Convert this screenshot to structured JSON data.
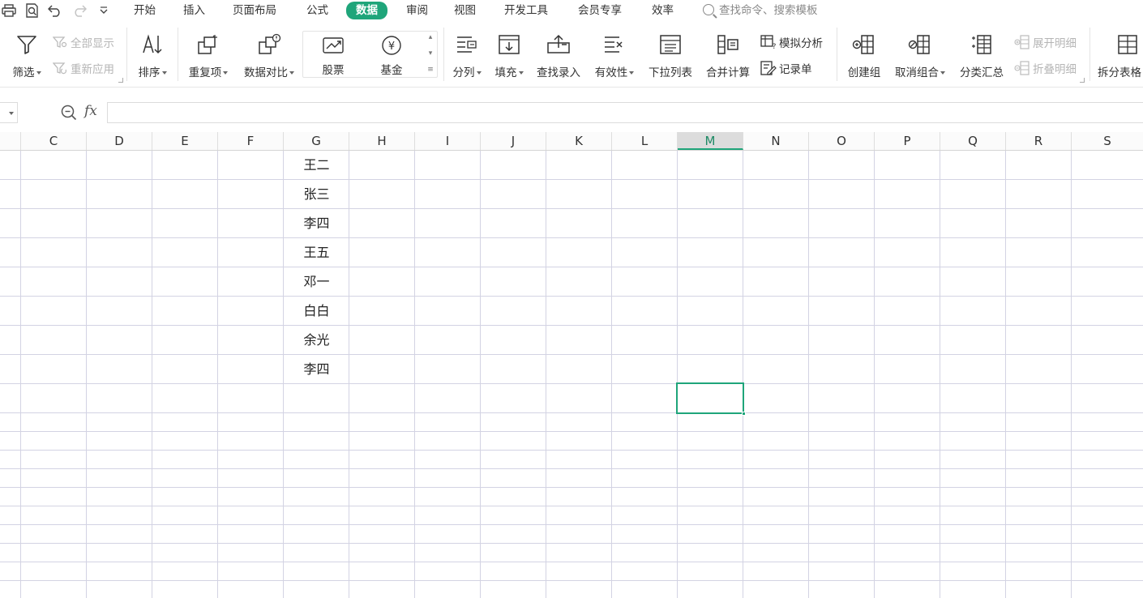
{
  "menu": {
    "tabs": [
      "开始",
      "插入",
      "页面布局",
      "公式",
      "数据",
      "审阅",
      "视图",
      "开发工具",
      "会员专享",
      "效率"
    ],
    "active_tab": "数据",
    "search_placeholder": "查找命令、搜索模板"
  },
  "ribbon": {
    "filter": "筛选",
    "show_all": "全部显示",
    "reapply": "重新应用",
    "sort": "排序",
    "duplicates": "重复项",
    "compare": "数据对比",
    "stock": "股票",
    "fund": "基金",
    "split_column": "分列",
    "fill": "填充",
    "lookup_entry": "查找录入",
    "validity": "有效性",
    "dropdown_list": "下拉列表",
    "consolidate": "合并计算",
    "what_if": "模拟分析",
    "record_form": "记录单",
    "create_group": "创建组",
    "ungroup": "取消组合",
    "subtotal": "分类汇总",
    "expand_detail": "展开明细",
    "collapse_detail": "折叠明细",
    "split_table": "拆分表格"
  },
  "formula_bar": {
    "fx_label": "fx",
    "value": ""
  },
  "grid": {
    "columns": [
      "C",
      "D",
      "E",
      "F",
      "G",
      "H",
      "I",
      "J",
      "K",
      "L",
      "M",
      "N",
      "O",
      "P",
      "Q",
      "R",
      "S"
    ],
    "selected_column": "M",
    "g_values": [
      "王二",
      "张三",
      "李四",
      "王五",
      "邓一",
      "白白",
      "余光",
      "李四"
    ]
  },
  "colors": {
    "accent": "#1fa57a",
    "gridline": "#d3d3e3"
  }
}
